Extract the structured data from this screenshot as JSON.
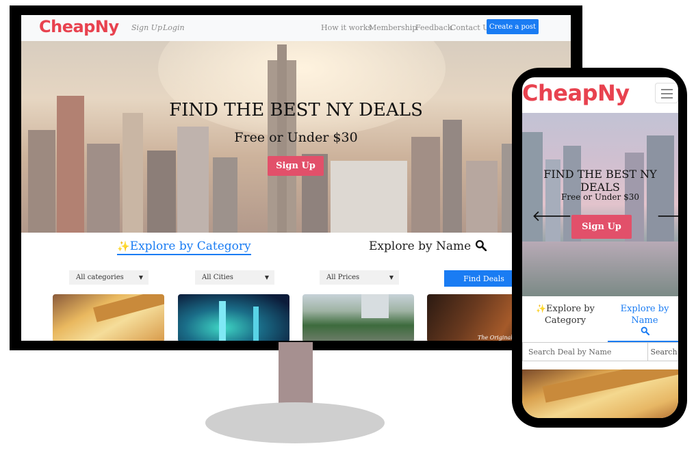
{
  "brand": {
    "logo": "CheapNy",
    "accent": "#e8424f",
    "primary": "#1a7cf3"
  },
  "desktop": {
    "nav": {
      "signup": "Sign Up",
      "login": "Login",
      "links": [
        "How it works",
        "Membership",
        "Feedback",
        "Contact Us"
      ],
      "create_post": "Create a post"
    },
    "hero": {
      "title": "FIND THE BEST NY DEALS",
      "subtitle": "Free or Under $30",
      "button": "Sign Up"
    },
    "tabs": {
      "category": "Explore by Category",
      "name": "Explore by Name"
    },
    "filters": {
      "categories": "All categories",
      "cities": "All Cities",
      "prices": "All Prices",
      "find": "Find Deals"
    },
    "cards": [
      {
        "image": "pizza"
      },
      {
        "image": "light-installation"
      },
      {
        "image": "park"
      },
      {
        "image": "restaurant",
        "caption": "The Original"
      }
    ]
  },
  "mobile": {
    "hero": {
      "title": "FIND THE BEST NY DEALS",
      "subtitle": "Free or Under $30",
      "button": "Sign Up"
    },
    "tabs": {
      "category_line1": "Explore by",
      "category_line2": "Category",
      "name": "Explore by Name"
    },
    "search": {
      "placeholder": "Search Deal by Name",
      "button": "Search"
    },
    "card": {
      "image": "pizza"
    }
  }
}
